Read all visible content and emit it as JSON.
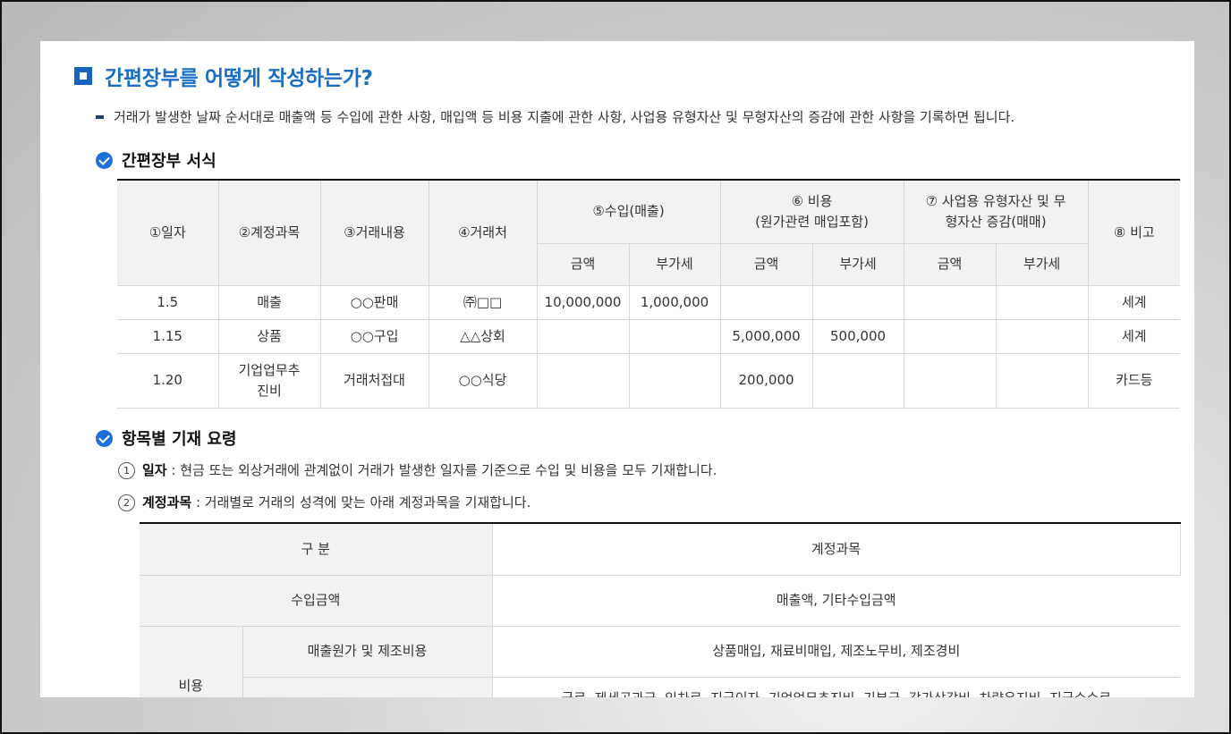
{
  "title": "간편장부를 어떻게 작성하는가?",
  "lead": "거래가 발생한 날짜 순서대로 매출액 등 수입에 관한 사항, 매입액 등 비용 지출에 관한 사항, 사업용 유형자산 및 무형자산의 증감에 관한 사항을 기록하면 됩니다.",
  "section1": {
    "title": "간편장부 서식"
  },
  "ledger": {
    "headers": {
      "date": "①일자",
      "account": "②계정과목",
      "description": "③거래내용",
      "partner": "④거래처",
      "income": "⑤수입(매출)",
      "expense_line1": "⑥ 비용",
      "expense_line2": "(원가관련 매입포함)",
      "assets_line1": "⑦ 사업용 유형자산 및 무",
      "assets_line2": "형자산 증감(매매)",
      "remark": "⑧ 비고",
      "amount": "금액",
      "vat": "부가세"
    },
    "rows": [
      {
        "date": "1.5",
        "account": "매출",
        "description": "○○판매",
        "partner": "㈜□□",
        "income_amount": "10,000,000",
        "income_vat": "1,000,000",
        "expense_amount": "",
        "expense_vat": "",
        "asset_amount": "",
        "asset_vat": "",
        "remark": "세계"
      },
      {
        "date": "1.15",
        "account": "상품",
        "description": "○○구입",
        "partner": "△△상회",
        "income_amount": "",
        "income_vat": "",
        "expense_amount": "5,000,000",
        "expense_vat": "500,000",
        "asset_amount": "",
        "asset_vat": "",
        "remark": "세계"
      },
      {
        "date": "1.20",
        "account_line1": "기업업무추",
        "account_line2": "진비",
        "description": "거래처접대",
        "partner": "○○식당",
        "income_amount": "",
        "income_vat": "",
        "expense_amount": "200,000",
        "expense_vat": "",
        "asset_amount": "",
        "asset_vat": "",
        "remark": "카드등"
      }
    ]
  },
  "section2": {
    "title": "항목별 기재 요령"
  },
  "items": [
    {
      "num": "1",
      "term": "일자",
      "text": " : 현금 또는 외상거래에 관계없이 거래가 발생한 일자를 기준으로 수입 및 비용을 모두 기재합니다."
    },
    {
      "num": "2",
      "term": "계정과목",
      "text": " : 거래별로 거래의 성격에 맞는 아래 계정과목을 기재합니다."
    }
  ],
  "accounts": {
    "header_category": "구 분",
    "header_accounts": "계정과목",
    "rows": [
      {
        "category": "수입금액",
        "accounts": "매출액, 기타수입금액"
      },
      {
        "group": "비용",
        "category": "매출원가 및 제조비용",
        "accounts": "상품매입, 재료비매입, 제조노무비, 제조경비"
      },
      {
        "category": "",
        "accounts": "급료, 제세공과금, 임차료, 지급이자, 기업업무추진비, 기부금, 감가상각비, 차량유지비, 지급수수료"
      }
    ]
  },
  "colors": {
    "accent": "#1a6fc4",
    "check": "#1e6fd9",
    "header_bg": "#f2f2f2"
  },
  "icons": {
    "title_marker": "square-bullet-icon",
    "section_marker": "check-circle-icon"
  }
}
